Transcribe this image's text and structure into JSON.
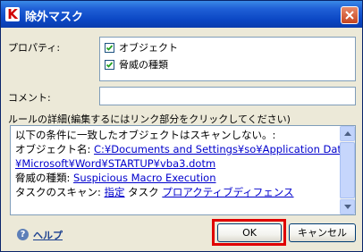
{
  "window": {
    "title": "除外マスク",
    "app_icon_letter": "K",
    "close_icon": "close-icon"
  },
  "properties": {
    "label": "プロパティ:",
    "items": [
      {
        "label": "オブジェクト",
        "checked": true
      },
      {
        "label": "脅威の種類",
        "checked": true
      }
    ]
  },
  "comment": {
    "label": "コメント:",
    "value": ""
  },
  "rules": {
    "label": "ルールの詳細(編集するにはリンク部分をクリックしてください)",
    "line1": "以下の条件に一致したオブジェクトはスキャンしない。:",
    "object_prefix": "オブジェクト名: ",
    "object_path_1": "C:¥Documents and Settings¥so¥Application Data",
    "object_path_2": "¥Microsoft¥Word¥STARTUP¥vba3.dotm",
    "threat_prefix": "脅威の種類: ",
    "threat_value": "Suspicious Macro Execution",
    "task_prefix": "タスクのスキャン: ",
    "task_link": "指定",
    "task_mid": " タスク ",
    "task_value": "プロアクティブディフェンス"
  },
  "footer": {
    "help_label": "ヘルプ",
    "ok_label": "OK",
    "cancel_label": "キャンセル"
  },
  "colors": {
    "titlebar": "#0b47c4",
    "highlight": "#e00000",
    "link": "#0000cc"
  }
}
